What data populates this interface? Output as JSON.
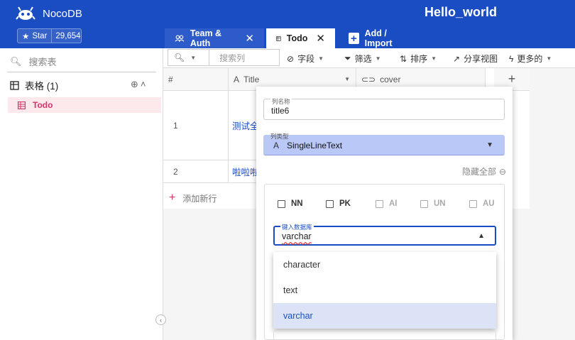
{
  "brand": {
    "name": "NocoDB",
    "star_label": "Star",
    "star_count": "29,654"
  },
  "project": {
    "title": "Hello_world"
  },
  "tabs": [
    {
      "label": "Team & Auth"
    },
    {
      "label": "Todo"
    },
    {
      "label": "Add / Import"
    }
  ],
  "sidebar": {
    "search_placeholder": "搜索表",
    "tables_header": "表格 (1)",
    "items": [
      {
        "label": "Todo"
      }
    ]
  },
  "toolbar": {
    "search_placeholder": "搜索列",
    "fields": "字段",
    "filter": "筛选",
    "sort": "排序",
    "share": "分享视图",
    "more": "更多的"
  },
  "grid": {
    "columns": [
      "#",
      "Title",
      "cover"
    ],
    "rows": [
      {
        "index": "1",
        "title": "测试全"
      },
      {
        "index": "2",
        "title": "啦啦啦"
      }
    ],
    "add_row": "添加新行"
  },
  "column_editor": {
    "name_label": "列名称",
    "name_value": "title6",
    "type_label": "列类型",
    "type_value": "SingleLineText",
    "hide_all": "隐藏全部",
    "checkboxes": [
      "NN",
      "PK",
      "AI",
      "UN",
      "AU"
    ],
    "db_type_label": "键入数据库",
    "db_type_value": "varchar",
    "db_type_options": [
      "character",
      "text",
      "varchar"
    ]
  },
  "colors": {
    "primary": "#1a4dc2",
    "accent": "#d6336c"
  }
}
